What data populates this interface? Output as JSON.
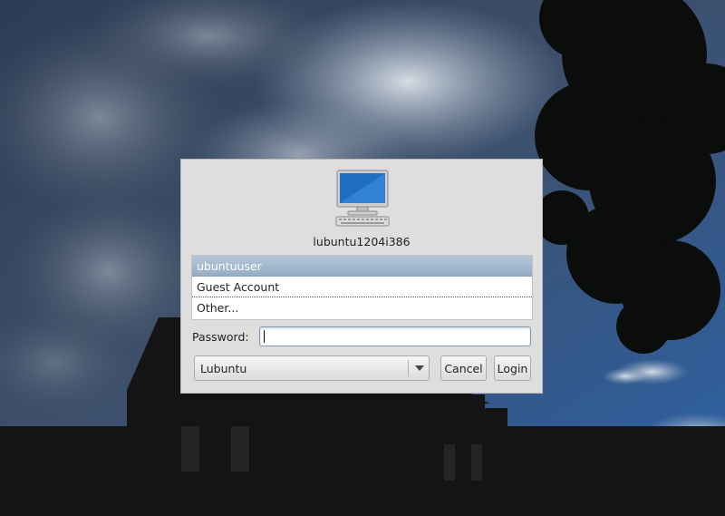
{
  "greeter": {
    "hostname": "lubuntu1204i386",
    "users": [
      {
        "label": "ubuntuuser",
        "selected": true
      },
      {
        "label": "Guest Account",
        "selected": false
      },
      {
        "label": "Other...",
        "selected": false
      }
    ],
    "password_label": "Password:",
    "password_value": "",
    "session_selected": "Lubuntu",
    "cancel_label": "Cancel",
    "login_label": "Login"
  },
  "icons": {
    "computer": "computer-monitor-icon",
    "dropdown": "chevron-down-icon"
  },
  "colors": {
    "dialog_bg": "#dedede",
    "selection": "#a3b9cf",
    "sky": "#203556"
  }
}
